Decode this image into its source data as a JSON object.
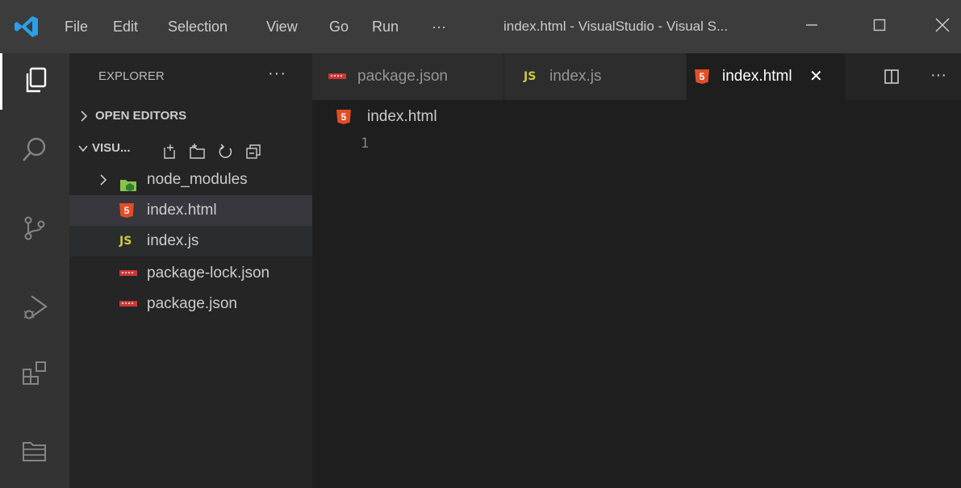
{
  "menu": {
    "items": [
      "File",
      "Edit",
      "Selection",
      "View",
      "Go",
      "Run",
      "···"
    ]
  },
  "window": {
    "title": "index.html - VisualStudio - Visual S...",
    "controls": [
      "minimize",
      "maximize",
      "close"
    ]
  },
  "activity_bar": {
    "icons": [
      "explorer-icon",
      "search-icon",
      "source-control-icon",
      "run-debug-icon",
      "extensions-icon",
      "remote-explorer-icon"
    ]
  },
  "sidebar": {
    "header": "EXPLORER",
    "more": "···",
    "open_editors": "OPEN EDITORS",
    "folder": "VISU...",
    "files": [
      {
        "name": "node_modules",
        "icon": "node-folder-icon",
        "kind": "folder"
      },
      {
        "name": "index.html",
        "icon": "html5-icon",
        "kind": "file"
      },
      {
        "name": "index.js",
        "icon": "js-icon",
        "kind": "file"
      },
      {
        "name": "package-lock.json",
        "icon": "npm-icon",
        "kind": "file"
      },
      {
        "name": "package.json",
        "icon": "npm-icon",
        "kind": "file"
      }
    ]
  },
  "tabs": [
    {
      "label": "package.json",
      "icon": "npm-icon",
      "active": false
    },
    {
      "label": "index.js",
      "icon": "js-icon",
      "active": false
    },
    {
      "label": "index.html",
      "icon": "html5-icon",
      "active": true
    }
  ],
  "tab_actions": {
    "more": "···"
  },
  "editor": {
    "breadcrumb": "index.html",
    "line_numbers": [
      "1"
    ]
  },
  "icons": {
    "html": "5",
    "js": "JS",
    "close": "✕"
  },
  "colors": {
    "accent": "#007acc",
    "html": "#e44d26",
    "js": "#cbcb41",
    "npm": "#cb3837"
  }
}
